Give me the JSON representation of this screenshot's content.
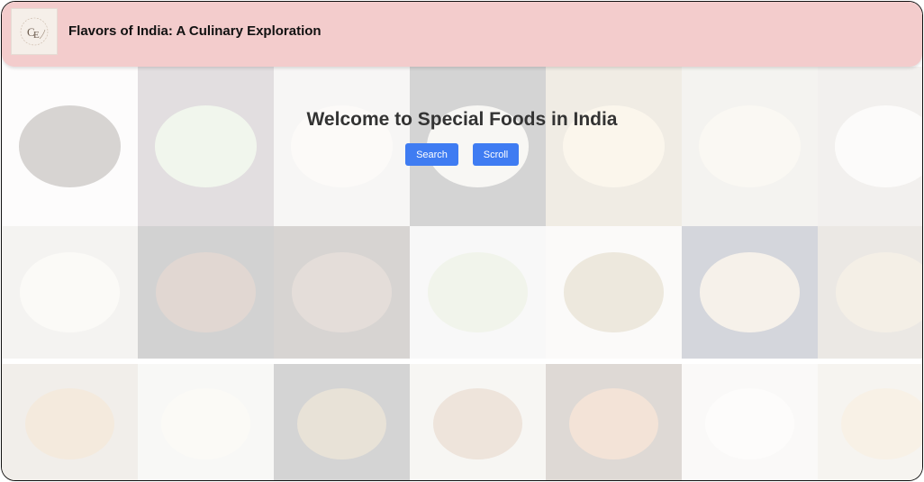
{
  "header": {
    "title": "Flavors of India: A Culinary Exploration",
    "logo_icon": "monogram-logo-icon"
  },
  "hero": {
    "heading": "Welcome to Special Foods in India",
    "search_label": "Search",
    "scroll_label": "Scroll"
  },
  "colors": {
    "header_bg": "#f3cccc",
    "button_bg": "#3f7cf2",
    "heading_text": "#333333"
  },
  "gallery": {
    "tiles": [
      {
        "name": "food-tile-sweets-dark",
        "bg": "#f2f0ee",
        "dish": "#3b2a22"
      },
      {
        "name": "food-tile-green-barfi",
        "bg": "#6d5b63",
        "dish": "#b9d3a4"
      },
      {
        "name": "food-tile-white-plate",
        "bg": "#d7d2cc",
        "dish": "#efe6db"
      },
      {
        "name": "food-tile-bowl",
        "bg": "#2b2b2b",
        "dish": "#d9d4c6"
      },
      {
        "name": "food-tile-rolls",
        "bg": "#b5a07a",
        "dish": "#e8d3a2"
      },
      {
        "name": "food-tile-payasam",
        "bg": "#c8c0b3",
        "dish": "#e6dcc0"
      },
      {
        "name": "food-tile-cups",
        "bg": "#bfb5a8",
        "dish": "#f1ece3"
      },
      {
        "name": "food-tile-tray-sweets",
        "bg": "#c9c3b9",
        "dish": "#e9e3d5"
      },
      {
        "name": "food-tile-gulab-jamun",
        "bg": "#1e1e1e",
        "dish": "#6a3a1f"
      },
      {
        "name": "food-tile-brown-bars",
        "bg": "#3a2a22",
        "dish": "#7a5840"
      },
      {
        "name": "food-tile-green-flat",
        "bg": "#d9d9d9",
        "dish": "#b8c99a"
      },
      {
        "name": "food-tile-mixture",
        "bg": "#e8e5df",
        "dish": "#a58c55"
      },
      {
        "name": "food-tile-round-sweets",
        "bg": "#2b3350",
        "dish": "#d3b995"
      },
      {
        "name": "food-tile-stack",
        "bg": "#9d8d78",
        "dish": "#c7ad83"
      },
      {
        "name": "food-tile-fried",
        "bg": "#b7ab97",
        "dish": "#c89556"
      },
      {
        "name": "food-tile-kheer",
        "bg": "#dcdad0",
        "dish": "#ece7d2"
      },
      {
        "name": "food-tile-chikki",
        "bg": "#2a2a2a",
        "dish": "#8a6e3a"
      },
      {
        "name": "food-tile-almonds",
        "bg": "#d8d0c2",
        "dish": "#a9784b"
      },
      {
        "name": "food-tile-halwa",
        "bg": "#5a4030",
        "dish": "#c2763a"
      },
      {
        "name": "food-tile-flower-sweet",
        "bg": "#e4e0da",
        "dish": "#f4f1ec"
      },
      {
        "name": "food-tile-laddu",
        "bg": "#cfc5b5",
        "dish": "#d9b982"
      }
    ]
  }
}
